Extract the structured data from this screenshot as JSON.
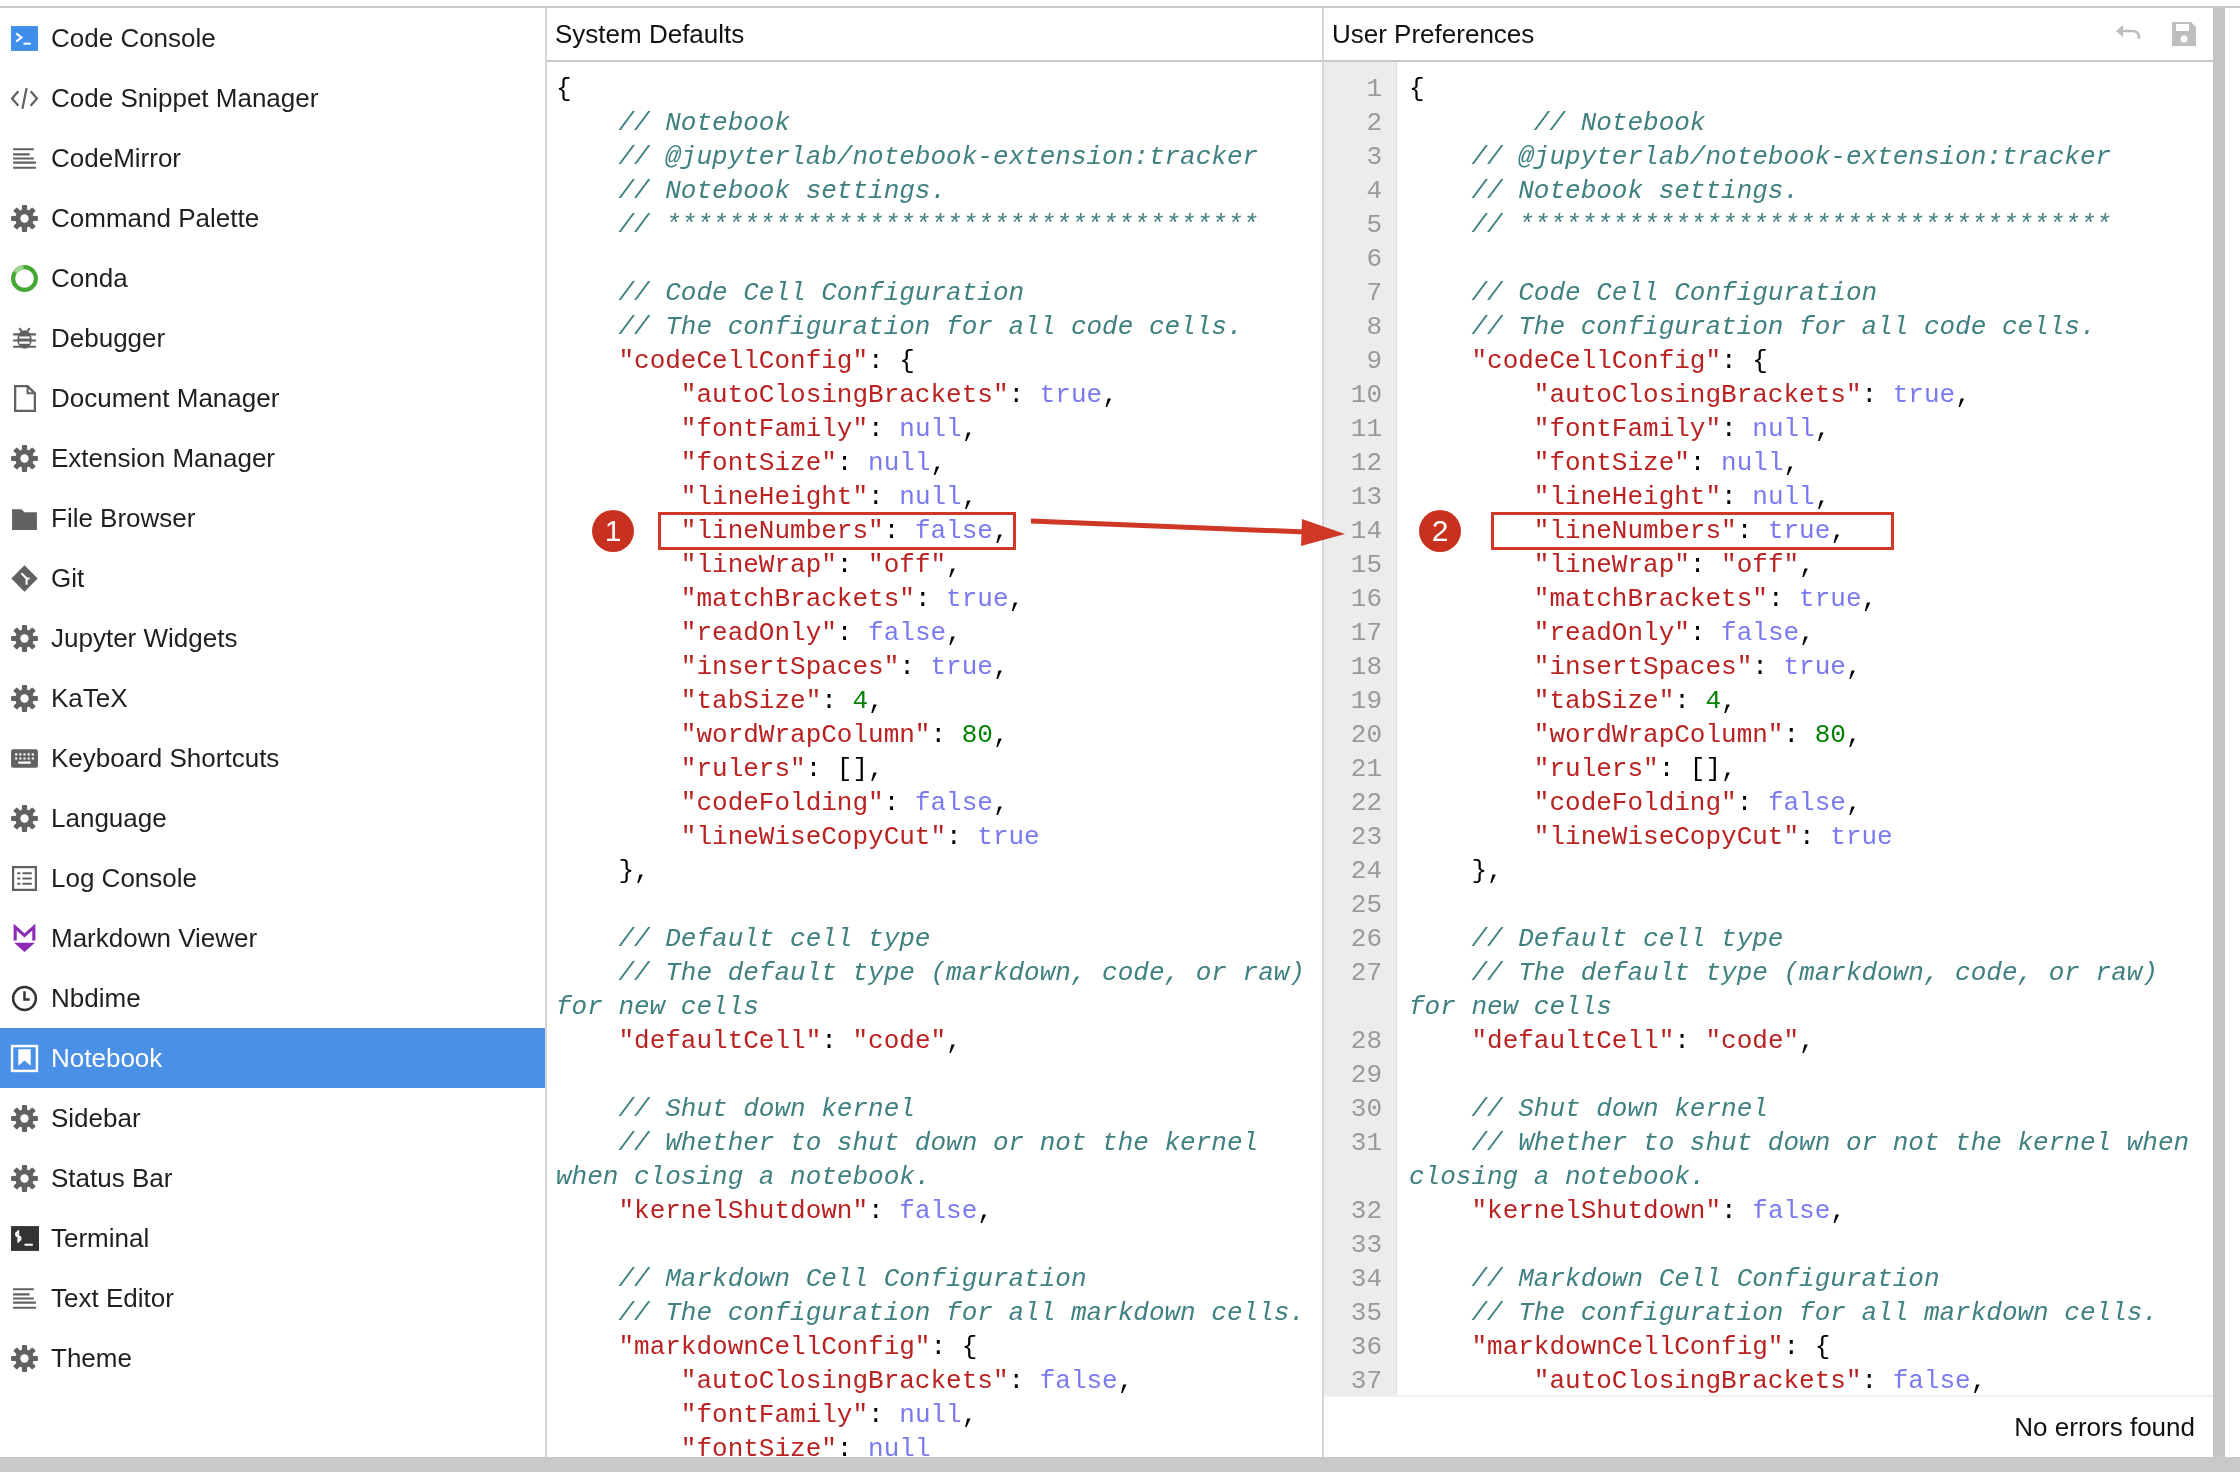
{
  "sidebar": {
    "items": [
      {
        "label": "Code Console",
        "kind": "console",
        "selected": false
      },
      {
        "label": "Code Snippet Manager",
        "kind": "code",
        "selected": false
      },
      {
        "label": "CodeMirror",
        "kind": "lines",
        "selected": false
      },
      {
        "label": "Command Palette",
        "kind": "gear",
        "selected": false
      },
      {
        "label": "Conda",
        "kind": "ring",
        "selected": false
      },
      {
        "label": "Debugger",
        "kind": "bug",
        "selected": false
      },
      {
        "label": "Document Manager",
        "kind": "document",
        "selected": false
      },
      {
        "label": "Extension Manager",
        "kind": "gear",
        "selected": false
      },
      {
        "label": "File Browser",
        "kind": "folder",
        "selected": false
      },
      {
        "label": "Git",
        "kind": "git",
        "selected": false
      },
      {
        "label": "Jupyter Widgets",
        "kind": "gear",
        "selected": false
      },
      {
        "label": "KaTeX",
        "kind": "gear",
        "selected": false
      },
      {
        "label": "Keyboard Shortcuts",
        "kind": "keyboard",
        "selected": false
      },
      {
        "label": "Language",
        "kind": "gear",
        "selected": false
      },
      {
        "label": "Log Console",
        "kind": "list",
        "selected": false
      },
      {
        "label": "Markdown Viewer",
        "kind": "markdown",
        "selected": false
      },
      {
        "label": "Nbdime",
        "kind": "clock",
        "selected": false
      },
      {
        "label": "Notebook",
        "kind": "bookmark",
        "selected": true
      },
      {
        "label": "Sidebar",
        "kind": "gear",
        "selected": false
      },
      {
        "label": "Status Bar",
        "kind": "gear",
        "selected": false
      },
      {
        "label": "Terminal",
        "kind": "terminal",
        "selected": false
      },
      {
        "label": "Text Editor",
        "kind": "lines",
        "selected": false
      },
      {
        "label": "Theme",
        "kind": "gear",
        "selected": false
      }
    ]
  },
  "system_defaults": {
    "title": "System Defaults",
    "lines": [
      {
        "kind": "code",
        "text": "{"
      },
      {
        "kind": "code",
        "text": "    // Notebook"
      },
      {
        "kind": "code",
        "text": "    // @jupyterlab/notebook-extension:tracker"
      },
      {
        "kind": "code",
        "text": "    // Notebook settings."
      },
      {
        "kind": "code",
        "text": "    // **************************************"
      },
      {
        "kind": "blank"
      },
      {
        "kind": "code",
        "text": "    // Code Cell Configuration"
      },
      {
        "kind": "code",
        "text": "    // The configuration for all code cells."
      },
      {
        "kind": "code",
        "text": "    \"codeCellConfig\": {"
      },
      {
        "kind": "code",
        "text": "        \"autoClosingBrackets\": true,"
      },
      {
        "kind": "code",
        "text": "        \"fontFamily\": null,"
      },
      {
        "kind": "code",
        "text": "        \"fontSize\": null,"
      },
      {
        "kind": "code",
        "text": "        \"lineHeight\": null,"
      },
      {
        "kind": "code",
        "text": "        \"lineNumbers\": false,"
      },
      {
        "kind": "code",
        "text": "        \"lineWrap\": \"off\","
      },
      {
        "kind": "code",
        "text": "        \"matchBrackets\": true,"
      },
      {
        "kind": "code",
        "text": "        \"readOnly\": false,"
      },
      {
        "kind": "code",
        "text": "        \"insertSpaces\": true,"
      },
      {
        "kind": "code",
        "text": "        \"tabSize\": 4,"
      },
      {
        "kind": "code",
        "text": "        \"wordWrapColumn\": 80,"
      },
      {
        "kind": "code",
        "text": "        \"rulers\": [],"
      },
      {
        "kind": "code",
        "text": "        \"codeFolding\": false,"
      },
      {
        "kind": "code",
        "text": "        \"lineWiseCopyCut\": true"
      },
      {
        "kind": "code",
        "text": "    },"
      },
      {
        "kind": "blank"
      },
      {
        "kind": "code",
        "text": "    // Default cell type"
      },
      {
        "kind": "code",
        "text": "    // The default type (markdown, code, or raw) for new cells"
      },
      {
        "kind": "code",
        "text": "    \"defaultCell\": \"code\","
      },
      {
        "kind": "blank"
      },
      {
        "kind": "code",
        "text": "    // Shut down kernel"
      },
      {
        "kind": "code",
        "text": "    // Whether to shut down or not the kernel when closing a notebook."
      },
      {
        "kind": "code",
        "text": "    \"kernelShutdown\": false,"
      },
      {
        "kind": "blank"
      },
      {
        "kind": "code",
        "text": "    // Markdown Cell Configuration"
      },
      {
        "kind": "code",
        "text": "    // The configuration for all markdown cells."
      },
      {
        "kind": "code",
        "text": "    \"markdownCellConfig\": {"
      },
      {
        "kind": "code",
        "text": "        \"autoClosingBrackets\": false,"
      },
      {
        "kind": "code",
        "text": "        \"fontFamily\": null,"
      },
      {
        "kind": "code",
        "text": "        \"fontSize\": null"
      }
    ]
  },
  "user_preferences": {
    "title": "User Preferences",
    "status": "No errors found",
    "lines": [
      {
        "number": "1",
        "text": "{"
      },
      {
        "number": "2",
        "text": "        // Notebook"
      },
      {
        "number": "3",
        "text": "    // @jupyterlab/notebook-extension:tracker"
      },
      {
        "number": "4",
        "text": "    // Notebook settings."
      },
      {
        "number": "5",
        "text": "    // **************************************"
      },
      {
        "number": "6"
      },
      {
        "number": "7",
        "text": "    // Code Cell Configuration"
      },
      {
        "number": "8",
        "text": "    // The configuration for all code cells."
      },
      {
        "number": "9",
        "text": "    \"codeCellConfig\": {"
      },
      {
        "number": "10",
        "text": "        \"autoClosingBrackets\": true,"
      },
      {
        "number": "11",
        "text": "        \"fontFamily\": null,"
      },
      {
        "number": "12",
        "text": "        \"fontSize\": null,"
      },
      {
        "number": "13",
        "text": "        \"lineHeight\": null,"
      },
      {
        "number": "14",
        "text": "        \"lineNumbers\": true,"
      },
      {
        "number": "15",
        "text": "        \"lineWrap\": \"off\","
      },
      {
        "number": "16",
        "text": "        \"matchBrackets\": true,"
      },
      {
        "number": "17",
        "text": "        \"readOnly\": false,"
      },
      {
        "number": "18",
        "text": "        \"insertSpaces\": true,"
      },
      {
        "number": "19",
        "text": "        \"tabSize\": 4,"
      },
      {
        "number": "20",
        "text": "        \"wordWrapColumn\": 80,"
      },
      {
        "number": "21",
        "text": "        \"rulers\": [],"
      },
      {
        "number": "22",
        "text": "        \"codeFolding\": false,"
      },
      {
        "number": "23",
        "text": "        \"lineWiseCopyCut\": true"
      },
      {
        "number": "24",
        "text": "    },"
      },
      {
        "number": "25"
      },
      {
        "number": "26",
        "text": "    // Default cell type"
      },
      {
        "number": "27",
        "text": "    // The default type (markdown, code, or raw) for new cells"
      },
      {
        "number": "28",
        "text": "    \"defaultCell\": \"code\","
      },
      {
        "number": "29"
      },
      {
        "number": "30",
        "text": "    // Shut down kernel"
      },
      {
        "number": "31",
        "text": "    // Whether to shut down or not the kernel when closing a notebook."
      },
      {
        "number": "32",
        "text": "    \"kernelShutdown\": false,"
      },
      {
        "number": "33"
      },
      {
        "number": "34",
        "text": "    // Markdown Cell Configuration"
      },
      {
        "number": "35",
        "text": "    // The configuration for all markdown cells."
      },
      {
        "number": "36",
        "text": "    \"markdownCellConfig\": {"
      },
      {
        "number": "37",
        "text": "        \"autoClosingBrackets\": false,"
      }
    ]
  },
  "annotations": [
    {
      "label": "1"
    },
    {
      "label": "2"
    }
  ]
}
